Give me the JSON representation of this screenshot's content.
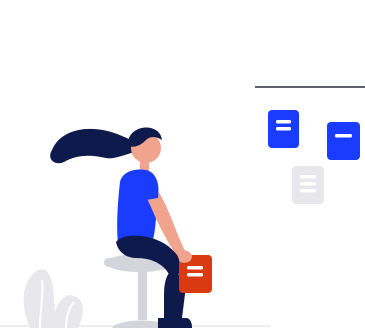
{
  "illustration": {
    "colors": {
      "background": "#ffffff",
      "primary_blue": "#1a3cff",
      "accent_red": "#d93a12",
      "navy": "#0e1a4b",
      "skin": "#f0a48e",
      "light_gray": "#e7e7ec",
      "mid_gray": "#d4d4dc",
      "line_dark": "#2c2e3a"
    },
    "icons": [
      "blue-sticky-note-icon",
      "blue-sticky-note-icon",
      "gray-sticky-note-icon",
      "red-sticky-note-icon",
      "plant-icon",
      "stool-icon",
      "person-icon"
    ]
  }
}
